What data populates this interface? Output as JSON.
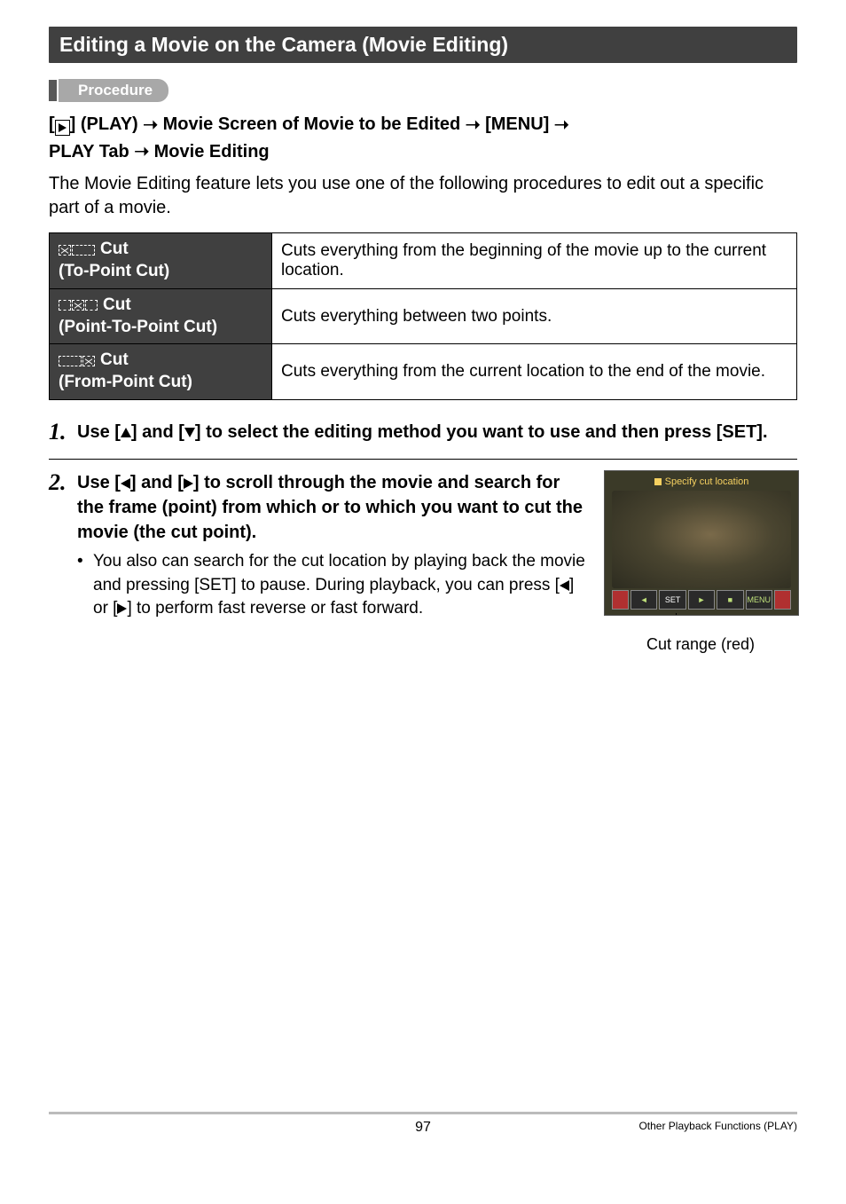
{
  "section_title": "Editing a Movie on the Camera (Movie Editing)",
  "procedure_label": "Procedure",
  "breadcrumb": {
    "part1": "] (PLAY) ",
    "part2": " Movie Screen of Movie to be Edited ",
    "part3": " [MENU] ",
    "part4": "PLAY Tab ",
    "part5": " Movie Editing"
  },
  "intro": "The Movie Editing feature lets you use one of the following procedures to edit out a specific part of a movie.",
  "table": {
    "rows": [
      {
        "label_top": " Cut",
        "label_sub": "(To-Point Cut)",
        "desc": "Cuts everything from the beginning of the movie up to the current location."
      },
      {
        "label_top": " Cut",
        "label_sub": "(Point-To-Point Cut)",
        "desc": "Cuts everything between two points."
      },
      {
        "label_top": " Cut",
        "label_sub": "(From-Point Cut)",
        "desc": "Cuts everything from the current location to the end of the movie."
      }
    ]
  },
  "steps": {
    "s1": {
      "num": "1.",
      "pre": "Use [",
      "mid": "] and [",
      "post": "] to select the editing method you want to use and then press [SET]."
    },
    "s2": {
      "num": "2.",
      "pre": "Use [",
      "mid": "] and [",
      "post": "] to scroll through the movie and search for the frame (point) from which or to which you want to cut the movie (the cut point).",
      "bullet_pre": "You also can search for the cut location by playing back the movie and pressing [SET] to pause. During playback, you can press [",
      "bullet_mid": "] or [",
      "bullet_post": "] to perform fast reverse or fast forward."
    }
  },
  "thumb": {
    "top": "Specify cut location",
    "set": "SET",
    "menu": "MENU"
  },
  "caption": "Cut range (red)",
  "footer": {
    "page": "97",
    "right": "Other Playback Functions (PLAY)"
  }
}
